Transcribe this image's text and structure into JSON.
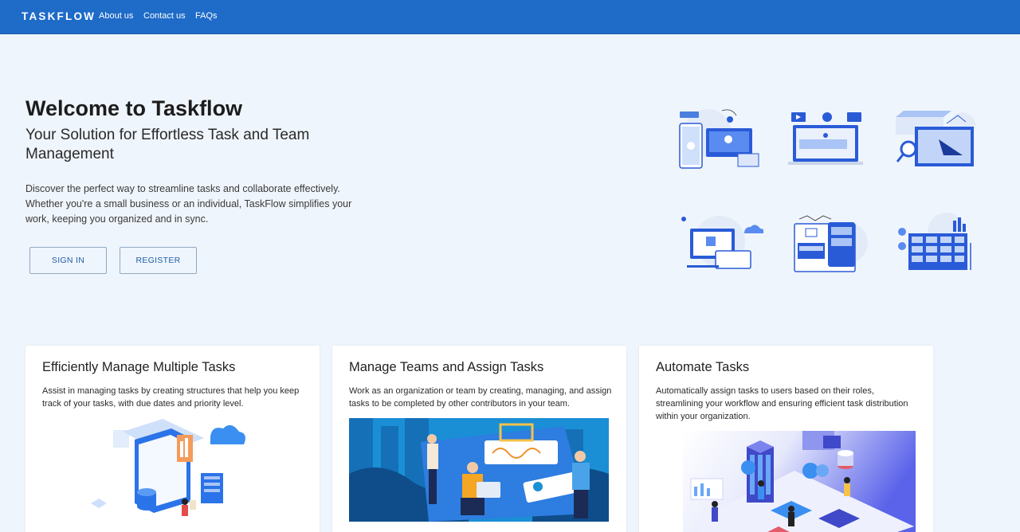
{
  "nav": {
    "brand": "TASKFLOW",
    "links": [
      "About us",
      "Contact us",
      "FAQs"
    ]
  },
  "hero": {
    "title": "Welcome to Taskflow",
    "subtitle": "Your Solution for Effortless Task and Team Management",
    "description": "Discover the perfect way to streamline tasks and collaborate effectively. Whether you're a small business or an individual, TaskFlow simplifies your work, keeping you organized and in sync.",
    "sign_in_label": "SIGN IN",
    "register_label": "REGISTER"
  },
  "cards": [
    {
      "title": "Efficiently Manage Multiple Tasks",
      "text": "Assist in managing tasks by creating structures that help you keep track of your tasks, with due dates and priority level."
    },
    {
      "title": "Manage Teams and Assign Tasks",
      "text": "Work as an organization or team by creating, managing, and assign tasks to be completed by other contributors in your team."
    },
    {
      "title": "Automate Tasks",
      "text": "Automatically assign tasks to users based on their roles, streamlining your workflow and ensuring efficient task distribution within your organization."
    }
  ],
  "colors": {
    "nav_bg": "#1e6bc8",
    "page_bg": "#eff5fc",
    "accent": "#1e5ea8"
  },
  "illustrations": [
    "mobile-devices-illustration",
    "media-dashboard-illustration",
    "analytics-search-illustration",
    "cloud-laptop-illustration",
    "shopping-apps-illustration",
    "spreadsheet-illustration"
  ]
}
